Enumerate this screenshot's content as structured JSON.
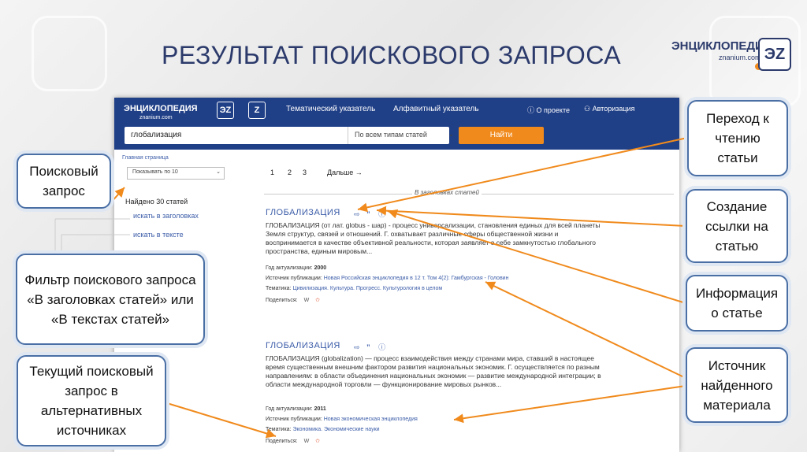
{
  "slide": {
    "title": "РЕЗУЛЬТАТ ПОИСКОВОГО ЗАПРОСА"
  },
  "logo": {
    "name": "ЭНЦИКЛОПЕДИЯ",
    "domain": "znanium.com",
    "mark": "ЭZ"
  },
  "site": {
    "logo_name": "ЭНЦИКЛОПЕДИЯ",
    "logo_domain": "znanium.com",
    "badge1": "ЭZ",
    "badge2": "Z",
    "nav": {
      "thematic": "Тематический указатель",
      "alphabetic": "Алфавитный указатель",
      "about": "О проекте",
      "auth": "Авторизация"
    },
    "search": {
      "value": "глобализация",
      "type": "По всем типам статей",
      "button": "Найти"
    },
    "breadcrumb": "Главная страница",
    "show": "Показывать по 10",
    "pages": [
      "1",
      "2",
      "3"
    ],
    "next": "Дальше →",
    "found": "Найдено 30 статей",
    "filters": [
      "искать в заголовках",
      "искать в тексте"
    ],
    "section": "В заголовках статей",
    "results": [
      {
        "title": "ГЛОБАЛИЗАЦИЯ",
        "body": "ГЛОБАЛИЗАЦИЯ (от лат. globus - шар) - процесс универсализации, становления единых для всей планеты Земля структур, связей и отношений. Г. охватывает различные сферы общественной жизни и воспринимается в качестве объективной реальности, которая заявляет о себе замкнутостью глобального пространства, единым мировым...",
        "year_label": "Год актуализации:",
        "year": "2000",
        "source_label": "Источник публикации:",
        "source": "Новая Российская энциклопедия в 12 т. Том 4(2): Гамбургская - Головин",
        "topic_label": "Тематика:",
        "topic": "Цивилизация. Культура. Прогресс. Культурология в целом",
        "share_label": "Поделиться:"
      },
      {
        "title": "ГЛОБАЛИЗАЦИЯ",
        "body": "ГЛОБАЛИЗАЦИЯ (globalization) — процесс взаимодействия между странами мира, ставший в настоящее время существенным внешним фактором развития национальных экономик. Г. осуществляется по разным направлениям: в области объединения национальных экономик — развитие международной интеграции; в области международной торговли — функционирование мировых рынков...",
        "year_label": "Год актуализации:",
        "year": "2011",
        "source_label": "Источник публикации:",
        "source": "Новая экономическая энциклопедия",
        "topic_label": "Тематика:",
        "topic": "Экономика. Экономические науки",
        "share_label": "Поделиться:"
      }
    ]
  },
  "callouts": {
    "search_query": "Поисковый запрос",
    "filter": "Фильтр поискового запроса «В заголовках статей» или «В текстах статей»",
    "alt_sources": "Текущий поисковый запрос в альтернативных источниках",
    "read": "Переход к чтению статьи",
    "link": "Создание ссылки на статью",
    "info": "Информация о статье",
    "source": "Источник найденного материала"
  },
  "colors": {
    "title": "#2b3a6b",
    "header": "#1f3f87",
    "accent": "#f08a1c",
    "link": "#3b5ca8",
    "callout_border": "#4a6fa5"
  }
}
